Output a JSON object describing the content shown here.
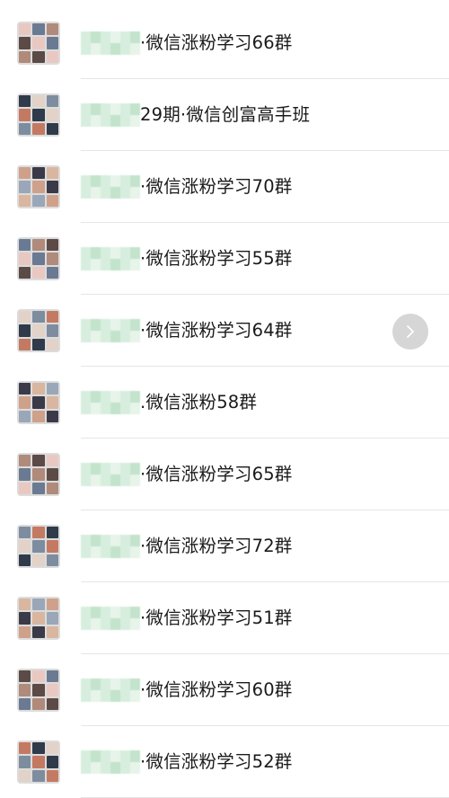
{
  "colors": {
    "background": "#ffffff",
    "divider": "#e6e6e6",
    "text": "#1a1a1a",
    "mosaic_green": "#c3e3cc",
    "float_button": "#c8c8c8"
  },
  "groups": [
    {
      "name": "·微信涨粉学习66群",
      "avatar_icon": "group-avatar-grid-icon"
    },
    {
      "name": "29期·微信创富高手班",
      "avatar_icon": "group-avatar-grid-icon"
    },
    {
      "name": "·微信涨粉学习70群",
      "avatar_icon": "group-avatar-grid-icon"
    },
    {
      "name": "·微信涨粉学习55群",
      "avatar_icon": "group-avatar-grid-icon"
    },
    {
      "name": "·微信涨粉学习64群",
      "avatar_icon": "group-avatar-grid-icon"
    },
    {
      "name": ".微信涨粉58群",
      "avatar_icon": "group-avatar-grid-icon"
    },
    {
      "name": "·微信涨粉学习65群",
      "avatar_icon": "group-avatar-grid-icon"
    },
    {
      "name": "·微信涨粉学习72群",
      "avatar_icon": "group-avatar-grid-icon"
    },
    {
      "name": "·微信涨粉学习51群",
      "avatar_icon": "group-avatar-grid-icon"
    },
    {
      "name": "·微信涨粉学习60群",
      "avatar_icon": "group-avatar-grid-icon"
    },
    {
      "name": "·微信涨粉学习52群",
      "avatar_icon": "group-avatar-grid-icon"
    }
  ],
  "floating_button": {
    "icon": "chevron-right-icon"
  }
}
